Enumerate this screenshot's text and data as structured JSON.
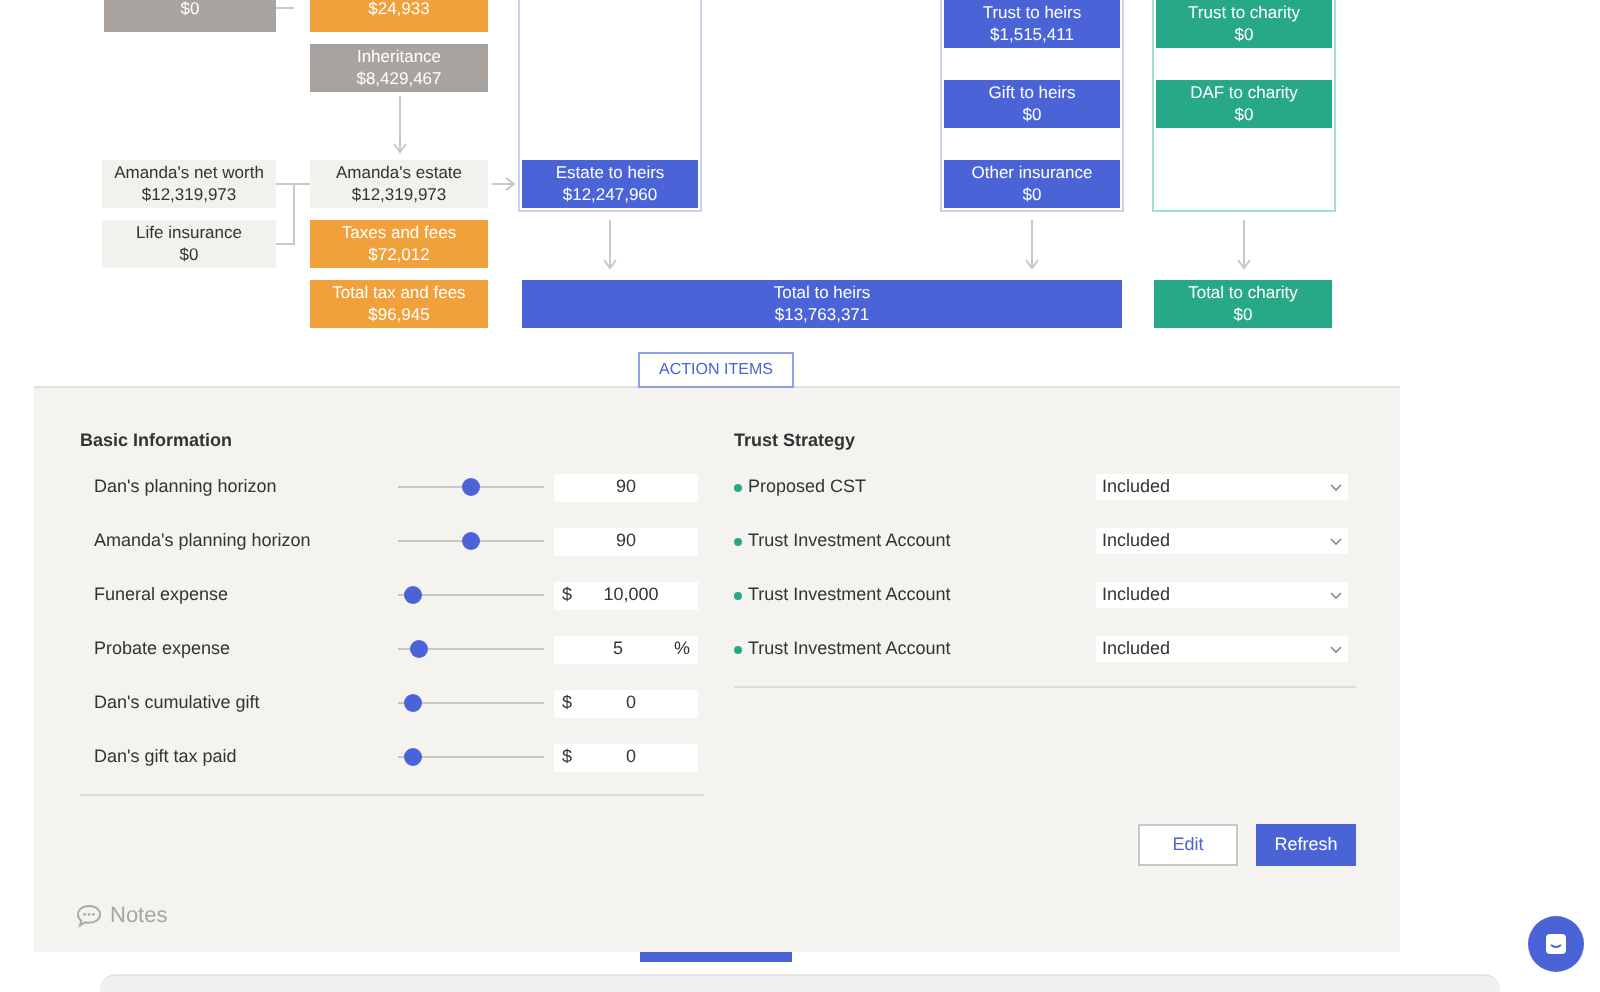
{
  "diagram": {
    "nodes": [
      {
        "kind": "gray",
        "value": "$0"
      },
      {
        "kind": "orange",
        "value": "$24,933"
      },
      {
        "kind": "gray",
        "label": "Inheritance",
        "value": "$8,429,467"
      },
      {
        "kind": "beige",
        "label": "Amanda's net worth",
        "value": "$12,319,973"
      },
      {
        "kind": "beige",
        "label": "Life insurance",
        "value": "$0"
      },
      {
        "kind": "beige",
        "label": "Amanda's estate",
        "value": "$12,319,973"
      },
      {
        "kind": "orange",
        "label": "Taxes and fees",
        "value": "$72,012"
      },
      {
        "kind": "orange",
        "label": "Total tax and fees",
        "value": "$96,945"
      },
      {
        "kind": "blue",
        "label": "Estate to heirs",
        "value": "$12,247,960"
      },
      {
        "kind": "blue",
        "label": "Trust to heirs",
        "value": "$1,515,411"
      },
      {
        "kind": "blue",
        "label": "Gift to heirs",
        "value": "$0"
      },
      {
        "kind": "blue",
        "label": "Other insurance",
        "value": "$0"
      },
      {
        "kind": "teal",
        "label": "Trust to charity",
        "value": "$0"
      },
      {
        "kind": "teal",
        "label": "DAF to charity",
        "value": "$0"
      },
      {
        "kind": "blue",
        "label": "Total to heirs",
        "value": "$13,763,371"
      },
      {
        "kind": "teal",
        "label": "Total to charity",
        "value": "$0"
      }
    ]
  },
  "action_items_button": "ACTION ITEMS",
  "basic_information": {
    "title": "Basic Information",
    "rows": [
      {
        "label": "Dan's planning horizon",
        "level": 0.5,
        "value": "90"
      },
      {
        "label": "Amanda's planning horizon",
        "level": 0.5,
        "value": "90"
      },
      {
        "label": "Funeral expense",
        "level": 0.05,
        "prefix": "$",
        "value": "10,000"
      },
      {
        "label": "Probate expense",
        "level": 0.1,
        "value": "5",
        "suffix": "%"
      },
      {
        "label": "Dan's cumulative gift",
        "level": 0.05,
        "prefix": "$",
        "value": "0"
      },
      {
        "label": "Dan's gift tax paid",
        "level": 0.05,
        "prefix": "$",
        "value": "0"
      }
    ]
  },
  "trust_strategy": {
    "title": "Trust Strategy",
    "rows": [
      {
        "label": "Proposed CST",
        "value": "Included"
      },
      {
        "label": "Trust Investment Account",
        "value": "Included"
      },
      {
        "label": "Trust Investment Account",
        "value": "Included"
      },
      {
        "label": "Trust Investment Account",
        "value": "Included"
      }
    ]
  },
  "buttons": [
    {
      "label": "Edit",
      "kind": "secondary"
    },
    {
      "label": "Refresh",
      "kind": "primary"
    }
  ],
  "notes": "Notes"
}
